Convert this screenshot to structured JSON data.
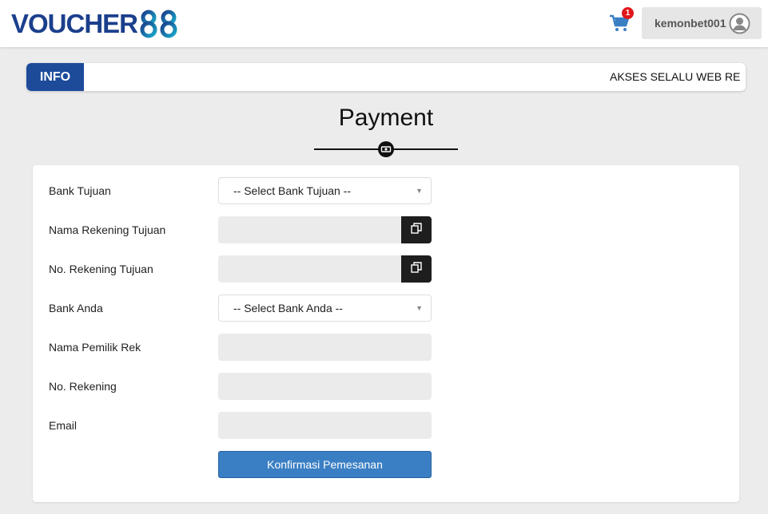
{
  "header": {
    "logo_text": "VOUCHER",
    "logo_suffix": "88",
    "cart_count": "1",
    "username": "kemonbet001"
  },
  "info": {
    "label": "INFO",
    "marquee": "AKSES SELALU WEB RES"
  },
  "page": {
    "title": "Payment"
  },
  "form": {
    "bank_tujuan_label": "Bank Tujuan",
    "bank_tujuan_select": "-- Select Bank Tujuan --",
    "nama_rek_tujuan_label": "Nama Rekening Tujuan",
    "no_rek_tujuan_label": "No. Rekening Tujuan",
    "bank_anda_label": "Bank Anda",
    "bank_anda_select": "-- Select Bank Anda --",
    "nama_pemilik_label": "Nama Pemilik Rek",
    "no_rekening_label": "No. Rekening",
    "email_label": "Email",
    "submit_label": "Konfirmasi Pemesanan"
  },
  "colors": {
    "brand_blue": "#1d4b9a",
    "button_blue": "#3a7fc4",
    "badge_red": "#e0161b"
  }
}
